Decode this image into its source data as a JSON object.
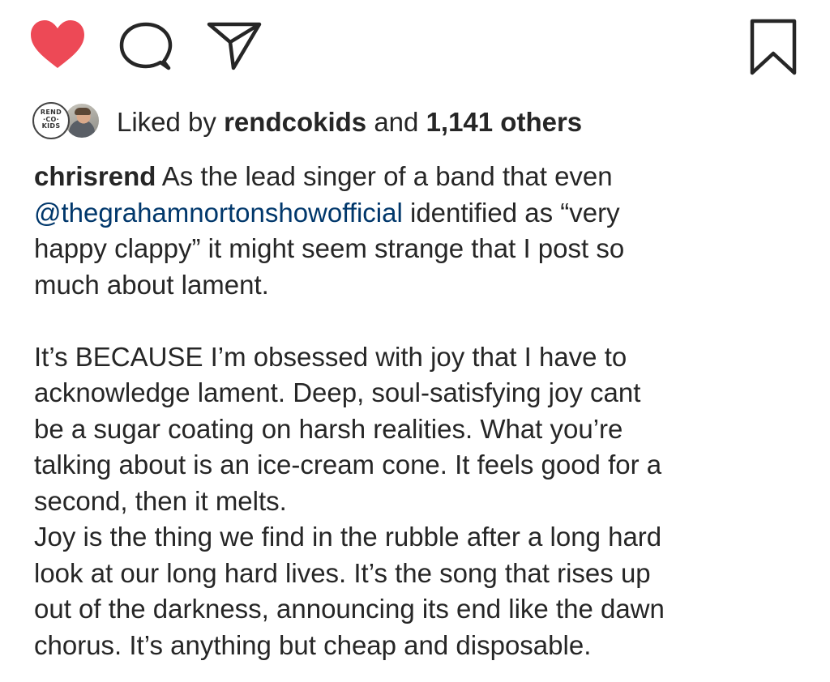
{
  "actions": {
    "like_icon": "heart-icon",
    "like_color": "#ed4956",
    "comment_icon": "comment-icon",
    "share_icon": "paper-plane-icon",
    "save_icon": "bookmark-icon"
  },
  "likes": {
    "prefix": "Liked by ",
    "user": "rendcokids",
    "connector": " and ",
    "others": "1,141 others",
    "avatar_logo_lines": [
      "REND",
      "·CO·",
      "KIDS"
    ]
  },
  "caption": {
    "username": "chrisrend",
    "intro_before_mention": " As the lead singer of a band that even\n",
    "mention": "@thegrahamnortonshowofficial",
    "intro_after_mention": " identified as “very\nhappy clappy” it might seem strange that I post so\nmuch about lament.",
    "paragraph_2": "It’s BECAUSE I’m obsessed with joy that I have to\nacknowledge lament. Deep, soul-satisfying joy cant\nbe a sugar coating on harsh realities. What you’re\ntalking about is an ice-cream cone. It feels good for a\nsecond, then it melts.",
    "paragraph_3": "Joy is the thing we find in the rubble after a long hard\nlook at our long hard lives. It’s the song that rises up\nout of the darkness, announcing its end like the dawn\nchorus. It’s anything but cheap and disposable."
  }
}
